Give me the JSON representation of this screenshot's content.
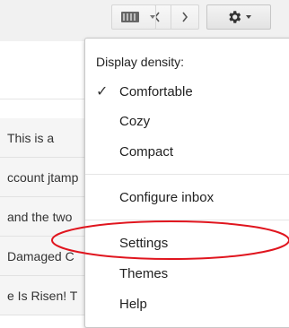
{
  "toolbar": {
    "prev_icon": "chevron-left-icon",
    "next_icon": "chevron-right-icon",
    "input_tools_icon": "keyboard-icon",
    "settings_icon": "gear-icon"
  },
  "email_list": {
    "rows": [
      "This is a",
      "ccount jtamp",
      "and the two",
      "Damaged C",
      "e Is Risen! T"
    ]
  },
  "settings_menu": {
    "density_label": "Display density:",
    "items": {
      "comfortable": "Comfortable",
      "cozy": "Cozy",
      "compact": "Compact",
      "configure_inbox": "Configure inbox",
      "settings": "Settings",
      "themes": "Themes",
      "help": "Help"
    },
    "checkmark": "✓",
    "selected_density": "Comfortable"
  },
  "annotation": {
    "color": "#e0151e"
  }
}
